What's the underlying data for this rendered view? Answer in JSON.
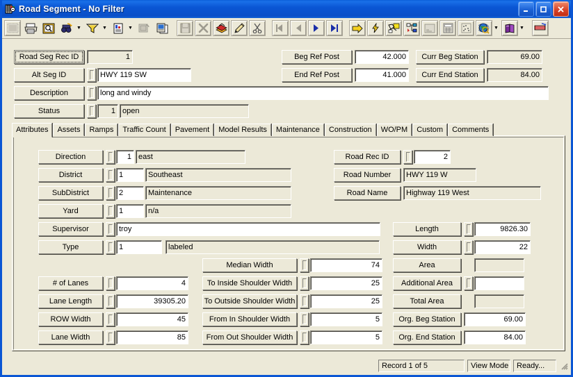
{
  "window": {
    "title": "Road Segment - No Filter",
    "icon": "app-icon",
    "buttons": {
      "minimize": "minimize",
      "maximize": "maximize",
      "close": "close"
    }
  },
  "toolbar": {
    "items": [
      {
        "name": "select-icon",
        "kind": "button",
        "framed": true,
        "glyph": "grid"
      },
      {
        "name": "print-icon",
        "kind": "button",
        "glyph": "printer"
      },
      {
        "name": "print-preview-icon",
        "kind": "button",
        "glyph": "preview"
      },
      {
        "name": "find-icon",
        "kind": "button",
        "glyph": "binoculars"
      },
      {
        "name": "find-dropdown",
        "kind": "dropdown"
      },
      {
        "name": "filter-icon",
        "kind": "button",
        "glyph": "funnel"
      },
      {
        "name": "filter-dropdown",
        "kind": "dropdown"
      },
      {
        "name": "report-icon",
        "kind": "button",
        "glyph": "report"
      },
      {
        "name": "report-dropdown",
        "kind": "dropdown"
      },
      {
        "name": "export-icon",
        "kind": "button",
        "glyph": "export"
      },
      {
        "name": "copy-icon",
        "kind": "button",
        "glyph": "copy"
      },
      {
        "name": "separator",
        "kind": "sep"
      },
      {
        "name": "save-icon",
        "kind": "button",
        "framed": true,
        "glyph": "save"
      },
      {
        "name": "delete-icon",
        "kind": "button",
        "framed": true,
        "glyph": "xmark"
      },
      {
        "name": "books-icon",
        "kind": "button",
        "framed": true,
        "glyph": "books"
      },
      {
        "name": "edit-icon",
        "kind": "button",
        "framed": true,
        "glyph": "pencil"
      },
      {
        "name": "cut-icon",
        "kind": "button",
        "framed": true,
        "glyph": "scissors"
      },
      {
        "name": "separator",
        "kind": "sep"
      },
      {
        "name": "first-record-icon",
        "kind": "button",
        "framed": true,
        "glyph": "first"
      },
      {
        "name": "previous-record-icon",
        "kind": "button",
        "framed": true,
        "glyph": "prev"
      },
      {
        "name": "next-record-icon",
        "kind": "button",
        "framed": true,
        "glyph": "next"
      },
      {
        "name": "last-record-icon",
        "kind": "button",
        "framed": true,
        "glyph": "last"
      },
      {
        "name": "separator",
        "kind": "sep"
      },
      {
        "name": "goto-icon",
        "kind": "button",
        "framed": true,
        "glyph": "arrow"
      },
      {
        "name": "lightning-icon",
        "kind": "button",
        "framed": true,
        "glyph": "bolt"
      },
      {
        "name": "network-icon",
        "kind": "button",
        "framed": true,
        "glyph": "network"
      },
      {
        "name": "tree-icon",
        "kind": "button",
        "framed": true,
        "glyph": "tree"
      },
      {
        "name": "note-icon",
        "kind": "button",
        "framed": true,
        "glyph": "note"
      },
      {
        "name": "calculator-icon",
        "kind": "button",
        "framed": true,
        "glyph": "calc"
      },
      {
        "name": "chart-icon",
        "kind": "button",
        "framed": true,
        "glyph": "scatter"
      },
      {
        "name": "map-icon",
        "kind": "button",
        "framed": true,
        "glyph": "globe"
      },
      {
        "name": "map-dropdown",
        "kind": "dropdown"
      },
      {
        "name": "help-icon",
        "kind": "button",
        "framed": true,
        "glyph": "book"
      },
      {
        "name": "help-dropdown",
        "kind": "dropdown"
      },
      {
        "name": "separator",
        "kind": "sep"
      },
      {
        "name": "layers-icon",
        "kind": "button",
        "framed": true,
        "glyph": "layers"
      }
    ]
  },
  "header": {
    "left": [
      {
        "label": "Road Seg Rec ID",
        "value": "1",
        "readonly": true,
        "align": "right",
        "lookup": false,
        "focused": true
      },
      {
        "label": "Alt Seg ID",
        "value": "HWY 119 SW",
        "readonly": false,
        "align": "left",
        "lookup": true
      },
      {
        "label": "Description",
        "value": "long and windy",
        "readonly": false,
        "align": "left",
        "lookup": true
      },
      {
        "label": "Status",
        "code": "1",
        "value": "open",
        "readonly": true,
        "align": "right",
        "lookup": true
      }
    ],
    "right": [
      {
        "label": "Beg Ref Post",
        "value": "42.000"
      },
      {
        "label": "End Ref Post",
        "value": "41.000"
      }
    ],
    "far_right": [
      {
        "label": "Curr Beg Station",
        "value": "69.00"
      },
      {
        "label": "Curr End Station",
        "value": "84.00"
      }
    ]
  },
  "tabs": [
    {
      "label": "Attributes",
      "active": true
    },
    {
      "label": "Assets",
      "active": false
    },
    {
      "label": "Ramps",
      "active": false
    },
    {
      "label": "Traffic Count",
      "active": false
    },
    {
      "label": "Pavement",
      "active": false
    },
    {
      "label": "Model Results",
      "active": false
    },
    {
      "label": "Maintenance",
      "active": false
    },
    {
      "label": "Construction",
      "active": false
    },
    {
      "label": "WO/PM",
      "active": false
    },
    {
      "label": "Custom",
      "active": false
    },
    {
      "label": "Comments",
      "active": false
    }
  ],
  "attributes": {
    "col1": [
      {
        "label": "Direction",
        "code": "1",
        "code_align": "right",
        "desc": "east",
        "lookup": true
      },
      {
        "label": "District",
        "code": "1",
        "code_align": "left",
        "desc": "Southeast",
        "lookup": true
      },
      {
        "label": "SubDistrict",
        "code": "2",
        "code_align": "left",
        "desc": "Maintenance",
        "lookup": true
      },
      {
        "label": "Yard",
        "code": "1",
        "code_align": "left",
        "desc": "n/a",
        "lookup": true
      },
      {
        "label": "Supervisor",
        "value": "troy",
        "lookup": true
      },
      {
        "label": "Type",
        "code": "1",
        "code_align": "left",
        "desc": "labeled",
        "lookup": true
      }
    ],
    "col2": [
      {
        "label": "Road Rec ID",
        "value": "2",
        "lookup": true,
        "readonly": false,
        "align": "right"
      },
      {
        "label": "Road Number",
        "value": "HWY 119 W",
        "lookup": false,
        "readonly": true,
        "align": "left"
      },
      {
        "label": "Road Name",
        "value": "Highway 119 West",
        "lookup": false,
        "readonly": true,
        "align": "left"
      }
    ],
    "right_measures": [
      {
        "label": "Length",
        "value": "9826.30",
        "lookup": true,
        "readonly": false
      },
      {
        "label": "Width",
        "value": "22",
        "lookup": true,
        "readonly": false
      }
    ],
    "lanes": [
      {
        "label": "# of Lanes",
        "value": "4",
        "lookup": true
      },
      {
        "label": "Lane Length",
        "value": "39305.20",
        "lookup": true
      },
      {
        "label": "ROW Width",
        "value": "45",
        "lookup": true
      },
      {
        "label": "Lane Width",
        "value": "85",
        "lookup": true
      }
    ],
    "shoulders": [
      {
        "label": "Median Width",
        "value": "74",
        "lookup": true
      },
      {
        "label": "To Inside Shoulder Width",
        "value": "25",
        "lookup": true
      },
      {
        "label": "To Outside Shoulder Width",
        "value": "25",
        "lookup": true
      },
      {
        "label": "From In Shoulder Width",
        "value": "5",
        "lookup": true
      },
      {
        "label": "From Out Shoulder Width",
        "value": "5",
        "lookup": true
      }
    ],
    "areas": [
      {
        "label": "Area",
        "value": "",
        "lookup": false,
        "readonly": true
      },
      {
        "label": "Additional Area",
        "value": "",
        "lookup": true,
        "readonly": false
      },
      {
        "label": "Total Area",
        "value": "",
        "lookup": false,
        "readonly": true
      },
      {
        "label": "Org. Beg Station",
        "value": "69.00",
        "lookup": false,
        "readonly": false
      },
      {
        "label": "Org. End Station",
        "value": "84.00",
        "lookup": false,
        "readonly": false
      }
    ]
  },
  "statusbar": {
    "record": "Record 1 of 5",
    "mode": "View Mode",
    "state": "Ready..."
  },
  "colors": {
    "title_blue": "#0a56d4",
    "face": "#ece9d8",
    "field": "#ffffff",
    "shadow": "#4d4b44"
  }
}
